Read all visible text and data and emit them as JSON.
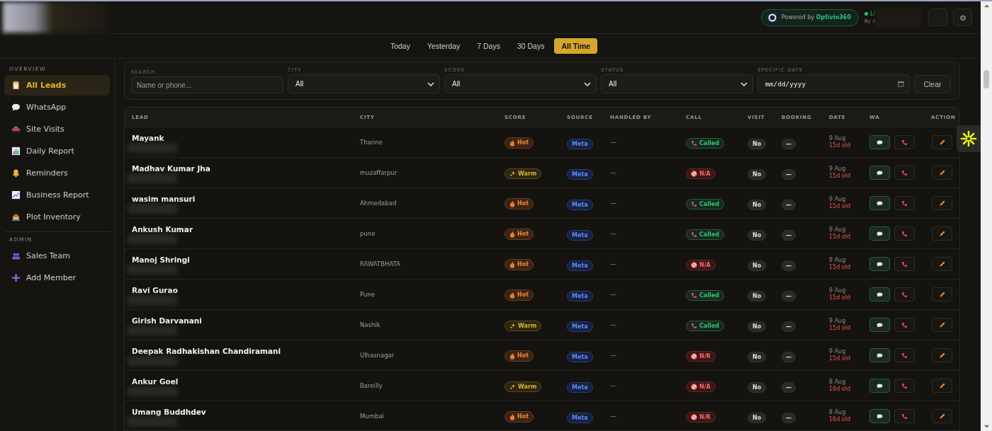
{
  "header": {
    "powered_prefix": "Powered by",
    "powered_brand": "Optivio360",
    "status_text": "Li",
    "status_sub": "By A"
  },
  "date_range": [
    {
      "label": "Today",
      "selected": false
    },
    {
      "label": "Yesterday",
      "selected": false
    },
    {
      "label": "7 Days",
      "selected": false
    },
    {
      "label": "30 Days",
      "selected": false
    },
    {
      "label": "All Time",
      "selected": true
    }
  ],
  "sidebar": {
    "sections": [
      {
        "title": "OVERVIEW",
        "items": [
          {
            "label": "All Leads",
            "selected": true
          },
          {
            "label": "WhatsApp",
            "selected": false
          },
          {
            "label": "Site Visits",
            "selected": false
          },
          {
            "label": "Daily Report",
            "selected": false
          },
          {
            "label": "Reminders",
            "selected": false
          },
          {
            "label": "Business Report",
            "selected": false
          },
          {
            "label": "Plot Inventory",
            "selected": false
          }
        ]
      },
      {
        "title": "ADMIN",
        "items": [
          {
            "label": "Sales Team",
            "selected": false
          },
          {
            "label": "Add Member",
            "selected": false
          }
        ]
      }
    ]
  },
  "filters": {
    "search": {
      "label": "SEARCH",
      "placeholder": "Name or phone..."
    },
    "city": {
      "label": "CITY",
      "value": "All"
    },
    "score": {
      "label": "SCORE",
      "value": "All"
    },
    "status": {
      "label": "STATUS",
      "value": "All"
    },
    "date": {
      "label": "SPECIFIC DATE",
      "placeholder": "mm/dd/yyyy"
    },
    "clear": "Clear"
  },
  "table": {
    "columns": [
      "LEAD",
      "CITY",
      "SCORE",
      "SOURCE",
      "HANDLED BY",
      "CALL",
      "VISIT",
      "BOOKING",
      "DATE",
      "WA",
      "ACTION"
    ],
    "rows": [
      {
        "name": "Mayank",
        "city": "Thanne",
        "score": {
          "kind": "hot",
          "label": "Hot"
        },
        "source": "Meta",
        "handled_by": "—",
        "call": {
          "kind": "called",
          "label": "Called"
        },
        "visit": "No",
        "booking": "—",
        "date": "9 Aug",
        "age": "15d old"
      },
      {
        "name": "Madhav Kumar Jha",
        "city": "muzaffarpur",
        "score": {
          "kind": "warm",
          "label": "Warm"
        },
        "source": "Meta",
        "handled_by": "—",
        "call": {
          "kind": "missed",
          "label": "N/A"
        },
        "visit": "No",
        "booking": "—",
        "date": "9 Aug",
        "age": "15d old"
      },
      {
        "name": "wasim mansuri",
        "city": "Ahmedabad",
        "score": {
          "kind": "hot",
          "label": "Hot"
        },
        "source": "Meta",
        "handled_by": "—",
        "call": {
          "kind": "called",
          "label": "Called"
        },
        "visit": "No",
        "booking": "—",
        "date": "9 Aug",
        "age": "15d old"
      },
      {
        "name": "Ankush Kumar",
        "city": "pune",
        "score": {
          "kind": "hot",
          "label": "Hot"
        },
        "source": "Meta",
        "handled_by": "—",
        "call": {
          "kind": "called",
          "label": "Called"
        },
        "visit": "No",
        "booking": "—",
        "date": "9 Aug",
        "age": "15d old"
      },
      {
        "name": "Manoj Shringi",
        "city": "RAWATBHATA",
        "score": {
          "kind": "hot",
          "label": "Hot"
        },
        "source": "Meta",
        "handled_by": "—",
        "call": {
          "kind": "missed",
          "label": "N/A"
        },
        "visit": "No",
        "booking": "—",
        "date": "9 Aug",
        "age": "15d old"
      },
      {
        "name": "Ravi Gurao",
        "city": "Pune",
        "score": {
          "kind": "hot",
          "label": "Hot"
        },
        "source": "Meta",
        "handled_by": "—",
        "call": {
          "kind": "called",
          "label": "Called"
        },
        "visit": "No",
        "booking": "—",
        "date": "9 Aug",
        "age": "15d old"
      },
      {
        "name": "Girish Darvanani",
        "city": "Nashik",
        "score": {
          "kind": "warm",
          "label": "Warm"
        },
        "source": "Meta",
        "handled_by": "—",
        "call": {
          "kind": "called",
          "label": "Called"
        },
        "visit": "No",
        "booking": "—",
        "date": "9 Aug",
        "age": "15d old"
      },
      {
        "name": "Deepak Radhakishan Chandiramani",
        "city": "Ulhasnagar",
        "score": {
          "kind": "hot",
          "label": "Hot"
        },
        "source": "Meta",
        "handled_by": "—",
        "call": {
          "kind": "missed",
          "label": "N/R"
        },
        "visit": "No",
        "booking": "—",
        "date": "9 Aug",
        "age": "15d old"
      },
      {
        "name": "Ankur Goel",
        "city": "Bareilly",
        "score": {
          "kind": "warm",
          "label": "Warm"
        },
        "source": "Meta",
        "handled_by": "—",
        "call": {
          "kind": "missed",
          "label": "N/A"
        },
        "visit": "No",
        "booking": "—",
        "date": "8 Aug",
        "age": "16d old"
      },
      {
        "name": "Umang Buddhdev",
        "city": "Mumbai",
        "score": {
          "kind": "hot",
          "label": "Hot"
        },
        "source": "Meta",
        "handled_by": "—",
        "call": {
          "kind": "missed",
          "label": "N/R"
        },
        "visit": "No",
        "booking": "—",
        "date": "8 Aug",
        "age": "16d old"
      }
    ]
  }
}
